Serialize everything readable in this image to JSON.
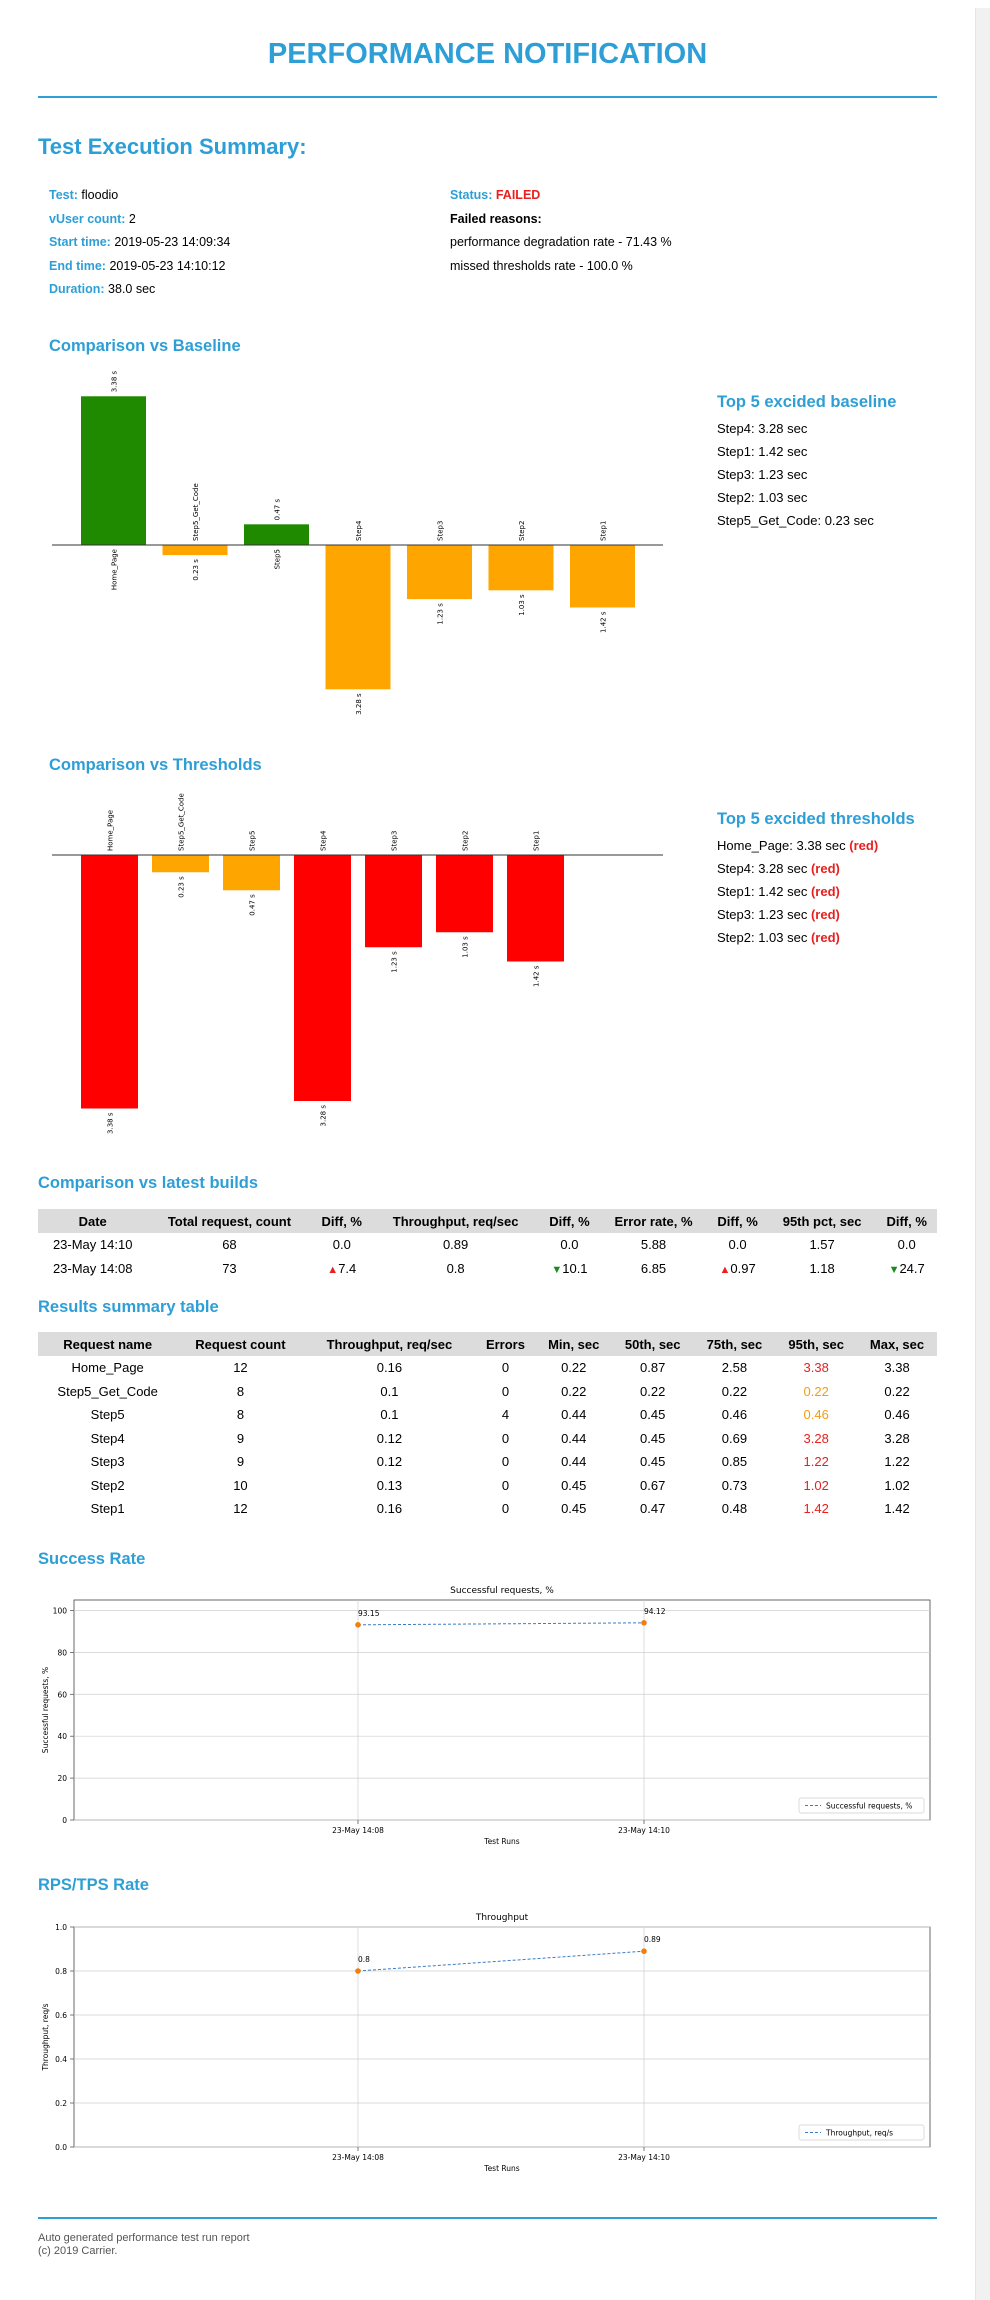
{
  "header": {
    "title": "PERFORMANCE NOTIFICATION"
  },
  "summary": {
    "title": "Test Execution Summary:",
    "left": [
      {
        "label": "Test:",
        "value": "floodio"
      },
      {
        "label": "vUser count:",
        "value": "2"
      },
      {
        "label": "Start time:",
        "value": "2019-05-23 14:09:34"
      },
      {
        "label": "End time:",
        "value": "2019-05-23 14:10:12"
      },
      {
        "label": "Duration:",
        "value": "38.0 sec"
      }
    ],
    "status_label": "Status:",
    "status_value": "FAILED",
    "failed_reasons_label": "Failed reasons:",
    "reasons": [
      "performance degradation rate - 71.43 %",
      "missed thresholds rate - 100.0 %"
    ]
  },
  "baseline": {
    "title": "Comparison vs Baseline",
    "top5_title": "Top 5 excided baseline",
    "top5": [
      "Step4: 3.28 sec",
      "Step1: 1.42 sec",
      "Step3: 1.23 sec",
      "Step2: 1.03 sec",
      "Step5_Get_Code: 0.23 sec"
    ]
  },
  "thresholds": {
    "title": "Comparison vs Thresholds",
    "top5_title": "Top 5 excided thresholds",
    "top5": [
      {
        "text": "Home_Page: 3.38 sec",
        "flag": "(red)"
      },
      {
        "text": "Step4: 3.28 sec",
        "flag": "(red)"
      },
      {
        "text": "Step1: 1.42 sec",
        "flag": "(red)"
      },
      {
        "text": "Step3: 1.23 sec",
        "flag": "(red)"
      },
      {
        "text": "Step2: 1.03 sec",
        "flag": "(red)"
      }
    ]
  },
  "builds": {
    "title": "Comparison vs latest builds",
    "columns": [
      "Date",
      "Total request, count",
      "Diff, %",
      "Throughput, req/sec",
      "Diff, %",
      "Error rate, %",
      "Diff, %",
      "95th pct, sec",
      "Diff, %"
    ],
    "rows": [
      {
        "date": "23-May 14:10",
        "total": "68",
        "d1": "0.0",
        "d1dir": "",
        "thr": "0.89",
        "d2": "0.0",
        "d2dir": "",
        "err": "5.88",
        "d3": "0.0",
        "d3dir": "",
        "p95": "1.57",
        "d4": "0.0",
        "d4dir": ""
      },
      {
        "date": "23-May 14:08",
        "total": "73",
        "d1": "7.4",
        "d1dir": "up",
        "thr": "0.8",
        "d2": "10.1",
        "d2dir": "down",
        "err": "6.85",
        "d3": "0.97",
        "d3dir": "up",
        "p95": "1.18",
        "d4": "24.7",
        "d4dir": "down"
      }
    ]
  },
  "results": {
    "title": "Results summary table",
    "columns": [
      "Request name",
      "Request count",
      "Throughput, req/sec",
      "Errors",
      "Min, sec",
      "50th, sec",
      "75th, sec",
      "95th, sec",
      "Max, sec"
    ],
    "rows": [
      {
        "name": "Home_Page",
        "count": "12",
        "thr": "0.16",
        "err": "0",
        "min": "0.22",
        "p50": "0.87",
        "p75": "2.58",
        "p95": "3.38",
        "p95color": "red",
        "max": "3.38"
      },
      {
        "name": "Step5_Get_Code",
        "count": "8",
        "thr": "0.1",
        "err": "0",
        "min": "0.22",
        "p50": "0.22",
        "p75": "0.22",
        "p95": "0.22",
        "p95color": "orange",
        "max": "0.22"
      },
      {
        "name": "Step5",
        "count": "8",
        "thr": "0.1",
        "err": "4",
        "min": "0.44",
        "p50": "0.45",
        "p75": "0.46",
        "p95": "0.46",
        "p95color": "orange",
        "max": "0.46"
      },
      {
        "name": "Step4",
        "count": "9",
        "thr": "0.12",
        "err": "0",
        "min": "0.44",
        "p50": "0.45",
        "p75": "0.69",
        "p95": "3.28",
        "p95color": "red",
        "max": "3.28"
      },
      {
        "name": "Step3",
        "count": "9",
        "thr": "0.12",
        "err": "0",
        "min": "0.44",
        "p50": "0.45",
        "p75": "0.85",
        "p95": "1.22",
        "p95color": "red",
        "max": "1.22"
      },
      {
        "name": "Step2",
        "count": "10",
        "thr": "0.13",
        "err": "0",
        "min": "0.45",
        "p50": "0.67",
        "p75": "0.73",
        "p95": "1.02",
        "p95color": "red",
        "max": "1.02"
      },
      {
        "name": "Step1",
        "count": "12",
        "thr": "0.16",
        "err": "0",
        "min": "0.45",
        "p50": "0.47",
        "p75": "0.48",
        "p95": "1.42",
        "p95color": "red",
        "max": "1.42"
      }
    ]
  },
  "success_section": {
    "title": "Success Rate"
  },
  "rps_section": {
    "title": "RPS/TPS Rate"
  },
  "footer": {
    "line1": "Auto generated performance test run report",
    "line2": "(c) 2019 Carrier."
  },
  "colors": {
    "accent": "#2e9fd6",
    "green": "#1f8a1f",
    "orange": "#ffa500",
    "red": "#ff0000"
  },
  "chart_data": [
    {
      "id": "baseline",
      "type": "bar",
      "categories": [
        "Home_Page",
        "Step5_Get_Code",
        "Step5",
        "Step4",
        "Step3",
        "Step2",
        "Step1"
      ],
      "values": [
        3.38,
        -0.23,
        0.47,
        -3.28,
        -1.23,
        -1.03,
        -1.42
      ],
      "labels": [
        "3.38 s",
        "0.23 s",
        "0.47 s",
        "3.28 s",
        "1.23 s",
        "1.03 s",
        "1.42 s"
      ],
      "colors": [
        "#1f8a00",
        "#ffa500",
        "#1f8a00",
        "#ffa500",
        "#ffa500",
        "#ffa500",
        "#ffa500"
      ],
      "ylim": [
        -3.6,
        3.6
      ]
    },
    {
      "id": "thresholds",
      "type": "bar",
      "categories": [
        "Home_Page",
        "Step5_Get_Code",
        "Step5",
        "Step4",
        "Step3",
        "Step2",
        "Step1"
      ],
      "values": [
        -3.38,
        -0.23,
        -0.47,
        -3.28,
        -1.23,
        -1.03,
        -1.42
      ],
      "labels": [
        "3.38 s",
        "0.23 s",
        "0.47 s",
        "3.28 s",
        "1.23 s",
        "1.03 s",
        "1.42 s"
      ],
      "colors": [
        "#ff0000",
        "#ffa500",
        "#ffa500",
        "#ff0000",
        "#ff0000",
        "#ff0000",
        "#ff0000"
      ],
      "ylim": [
        -3.5,
        0.1
      ]
    },
    {
      "id": "success",
      "type": "line",
      "title": "Successful requests, %",
      "xlabel": "Test Runs",
      "ylabel": "Successful requests, %",
      "x": [
        "23-May 14:08",
        "23-May 14:10"
      ],
      "series": [
        {
          "name": "Successful requests, %",
          "values": [
            93.15,
            94.12
          ]
        }
      ],
      "ylim": [
        0,
        105
      ],
      "yticks": [
        "0",
        "20",
        "40",
        "60",
        "80",
        "100"
      ],
      "ytick_values": [
        0,
        20,
        40,
        60,
        80,
        100
      ],
      "grid": true,
      "legend": "lower-right"
    },
    {
      "id": "rps",
      "type": "line",
      "title": "Throughput",
      "xlabel": "Test Runs",
      "ylabel": "Throughput, req/s",
      "x": [
        "23-May 14:08",
        "23-May 14:10"
      ],
      "series": [
        {
          "name": "Throughput, req/s",
          "values": [
            0.8,
            0.89
          ]
        }
      ],
      "ylim": [
        0,
        1.0
      ],
      "yticks": [
        "0.0",
        "0.2",
        "0.4",
        "0.6",
        "0.8",
        "1.0"
      ],
      "ytick_values": [
        0,
        0.2,
        0.4,
        0.6,
        0.8,
        1.0
      ],
      "grid": true,
      "legend": "lower-right"
    }
  ]
}
